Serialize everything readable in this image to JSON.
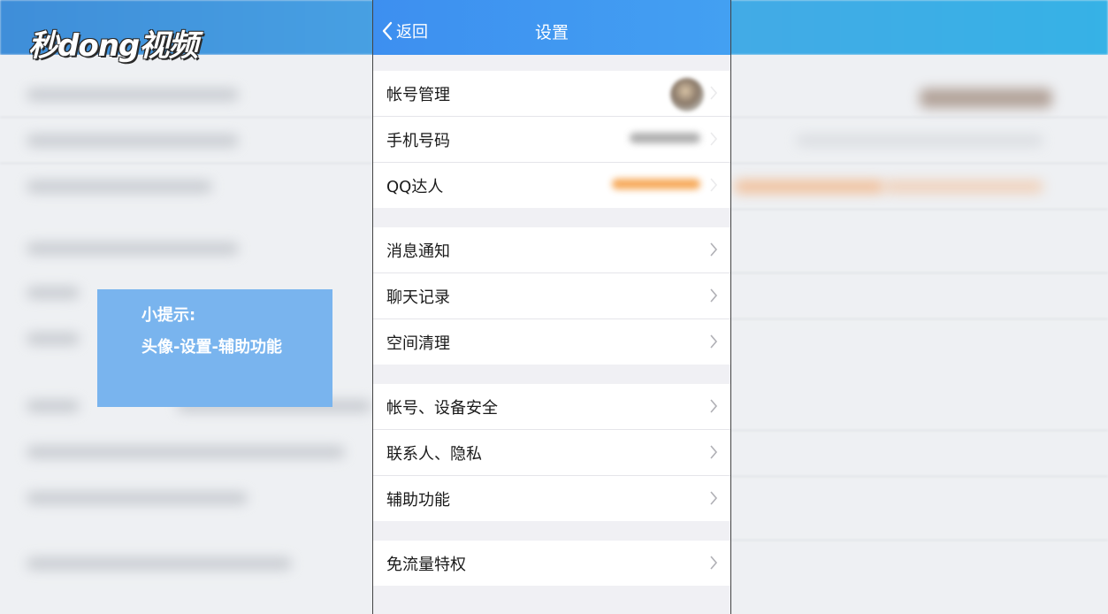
{
  "watermark": {
    "logo_text": "秒dong视频"
  },
  "tip": {
    "title": "小提示:",
    "text": "头像-设置-辅助功能"
  },
  "nav": {
    "back_label": "返回",
    "title": "设置"
  },
  "settings": {
    "group1": [
      {
        "label": "帐号管理"
      },
      {
        "label": "手机号码"
      },
      {
        "label": "QQ达人"
      }
    ],
    "group2": [
      {
        "label": "消息通知"
      },
      {
        "label": "聊天记录"
      },
      {
        "label": "空间清理"
      }
    ],
    "group3": [
      {
        "label": "帐号、设备安全"
      },
      {
        "label": "联系人、隐私"
      },
      {
        "label": "辅助功能"
      }
    ],
    "group4": [
      {
        "label": "免流量特权"
      }
    ]
  },
  "colors": {
    "nav_bar": "#3d8ff0",
    "tip_card": "#79b4ee",
    "page_bg": "#f0f0f4"
  }
}
